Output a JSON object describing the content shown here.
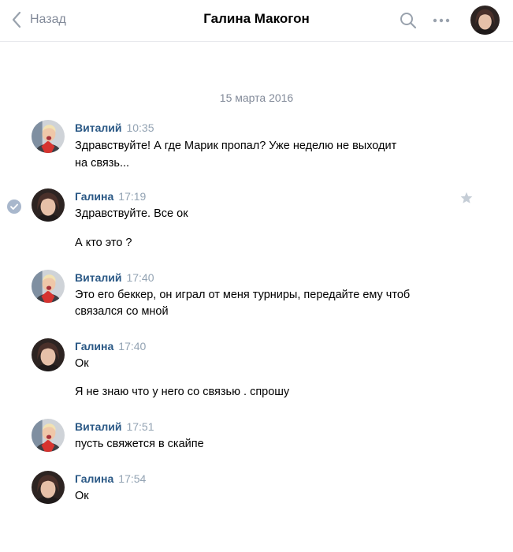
{
  "header": {
    "back_label": "Назад",
    "title": "Галина Макогон",
    "icons": [
      "chevron-left-icon",
      "search-icon",
      "more-icon",
      "avatar"
    ]
  },
  "date_separator": "15 марта 2016",
  "messages": [
    {
      "author": "Виталий",
      "time": "10:35",
      "lines": [
        "Здравствуйте! А где Марик пропал? Уже неделю не выходит",
        "на связь..."
      ]
    },
    {
      "author": "Галина",
      "time": "17:19",
      "lines": [
        "Здравствуйте. Все ок",
        "А кто это ?"
      ],
      "read_check": true,
      "star": true
    },
    {
      "author": "Виталий",
      "time": "17:40",
      "lines": [
        "Это его беккер, он играл от меня турниры, передайте ему чтоб",
        "связался со мной"
      ]
    },
    {
      "author": "Галина",
      "time": "17:40",
      "lines": [
        "Ок",
        "Я не знаю что у него со связью . спрошу"
      ]
    },
    {
      "author": "Виталий",
      "time": "17:51",
      "lines": [
        "пусть свяжется в скайпе"
      ]
    },
    {
      "author": "Галина",
      "time": "17:54",
      "lines": [
        "Ок"
      ]
    }
  ],
  "colors": {
    "author": "#2a5885",
    "time": "#93a3b3",
    "muted": "#828a99",
    "check": "#a8b7cc",
    "star": "#c5cdd6"
  }
}
